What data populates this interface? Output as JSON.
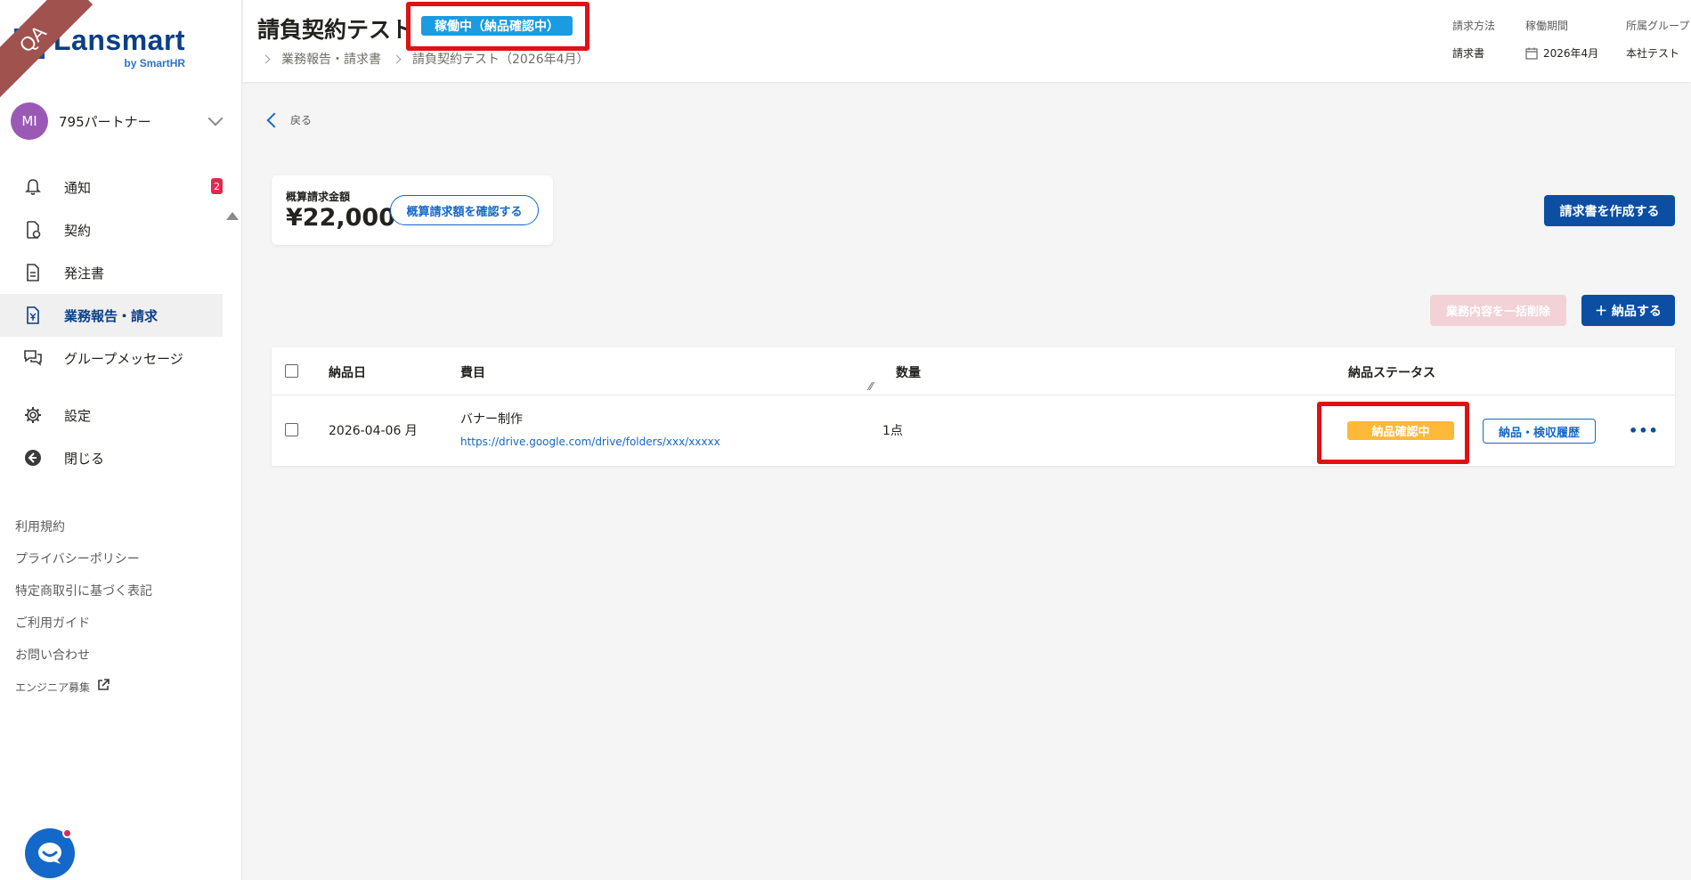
{
  "env_badge": "QA",
  "brand": {
    "name": "Lansmart",
    "sub": "by SmartHR"
  },
  "account": {
    "initials": "MI",
    "name": "795パートナー"
  },
  "nav": {
    "notifications": {
      "label": "通知",
      "badge": "2"
    },
    "contracts": "契約",
    "orders": "発注書",
    "reports": "業務報告・請求",
    "group_messages": "グループメッセージ",
    "settings": "設定",
    "close": "閉じる"
  },
  "footer": {
    "terms": "利用規約",
    "privacy": "プライバシーポリシー",
    "commerce": "特定商取引に基づく表記",
    "guide": "ご利用ガイド",
    "contact": "お問い合わせ",
    "jobs": "エンジニア募集"
  },
  "header": {
    "title": "請負契約テスト",
    "status": "稼働中（納品確認中）",
    "breadcrumb": [
      "業務報告・請求書",
      "請負契約テスト（2026年4月）"
    ],
    "meta": {
      "billing_method": {
        "label": "請求方法",
        "value": "請求書"
      },
      "period": {
        "label": "稼働期間",
        "value": "2026年4月"
      },
      "group": {
        "label": "所属グループ",
        "value": "本社テスト"
      }
    }
  },
  "main": {
    "back": "戻る",
    "estimate": {
      "label": "概算請求金額",
      "value": "¥22,000",
      "confirm_button": "概算請求額を確認する"
    },
    "create_invoice_button": "請求書を作成する",
    "bulk_delete_button": "業務内容を一括削除",
    "deliver_button": "＋ 納品する",
    "table": {
      "columns": [
        "納品日",
        "費目",
        "数量",
        "納品ステータス"
      ],
      "rows": [
        {
          "date": "2026-04-06 月",
          "item": "バナー制作",
          "link": "https://drive.google.com/drive/folders/xxx/xxxxx",
          "quantity": "1点",
          "status": "納品確認中",
          "history_button": "納品・検収履歴"
        }
      ]
    }
  },
  "colors": {
    "brand": "#0b3f86",
    "primary": "#0b4ea2",
    "link": "#1468c9",
    "status_active": "#1b9be0",
    "status_pending": "#ffb938",
    "highlight": "#e01111"
  }
}
